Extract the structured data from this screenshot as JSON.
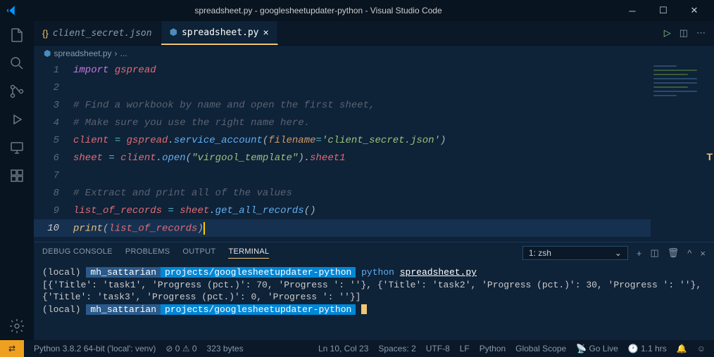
{
  "window": {
    "title": "spreadsheet.py - googlesheetupdater-python - Visual Studio Code"
  },
  "tabs": [
    {
      "icon": "{}",
      "label": "client_secret.json",
      "active": false
    },
    {
      "icon": "🐍",
      "label": "spreadsheet.py",
      "active": true
    }
  ],
  "breadcrumb": {
    "icon": "🐍",
    "file": "spreadsheet.py",
    "more": "..."
  },
  "editor": {
    "lines": [
      {
        "num": 1,
        "tokens": [
          [
            "kw",
            "import"
          ],
          [
            "",
            " "
          ],
          [
            "mod",
            "gspread"
          ]
        ]
      },
      {
        "num": 2,
        "tokens": []
      },
      {
        "num": 3,
        "tokens": [
          [
            "comment",
            "# Find a workbook by name and open the first sheet,"
          ]
        ]
      },
      {
        "num": 4,
        "tokens": [
          [
            "comment",
            "# Make sure you use the right name here."
          ]
        ]
      },
      {
        "num": 5,
        "tokens": [
          [
            "ident",
            "client"
          ],
          [
            "",
            " "
          ],
          [
            "op",
            "="
          ],
          [
            "",
            " "
          ],
          [
            "ident",
            "gspread"
          ],
          [
            "punct",
            "."
          ],
          [
            "func",
            "service_account"
          ],
          [
            "punct",
            "("
          ],
          [
            "param",
            "filename"
          ],
          [
            "op",
            "="
          ],
          [
            "string",
            "'client_secret.json'"
          ],
          [
            "punct",
            ")"
          ]
        ]
      },
      {
        "num": 6,
        "tokens": [
          [
            "ident",
            "sheet"
          ],
          [
            "",
            " "
          ],
          [
            "op",
            "="
          ],
          [
            "",
            " "
          ],
          [
            "ident",
            "client"
          ],
          [
            "punct",
            "."
          ],
          [
            "func",
            "open"
          ],
          [
            "punct",
            "("
          ],
          [
            "string",
            "\"virgool_template\""
          ],
          [
            "punct",
            ")"
          ],
          [
            "punct",
            "."
          ],
          [
            "ident",
            "sheet1"
          ]
        ]
      },
      {
        "num": 7,
        "tokens": []
      },
      {
        "num": 8,
        "tokens": [
          [
            "comment",
            "# Extract and print all of the values"
          ]
        ]
      },
      {
        "num": 9,
        "tokens": [
          [
            "ident",
            "list_of_records"
          ],
          [
            "",
            " "
          ],
          [
            "op",
            "="
          ],
          [
            "",
            " "
          ],
          [
            "ident",
            "sheet"
          ],
          [
            "punct",
            "."
          ],
          [
            "func",
            "get_all_records"
          ],
          [
            "punct",
            "()"
          ]
        ]
      },
      {
        "num": 10,
        "highlighted": true,
        "tokens": [
          [
            "builtin",
            "print"
          ],
          [
            "punct",
            "("
          ],
          [
            "ident",
            "list_of_records"
          ],
          [
            "punct",
            ")"
          ]
        ],
        "cursor": true
      }
    ]
  },
  "panel": {
    "tabs": [
      "DEBUG CONSOLE",
      "PROBLEMS",
      "OUTPUT",
      "TERMINAL"
    ],
    "active": "TERMINAL",
    "term_select": "1: zsh"
  },
  "terminal": {
    "local": "(local)",
    "user": "mh_sattarian",
    "path": "projects/googlesheetupdater-python",
    "cmd": "python",
    "file": "spreadsheet.py",
    "output": "[{'Title': 'task1', 'Progress (pct.)': 70, 'Progress ': ''}, {'Title': 'task2', 'Progress (pct.)': 30, 'Progress ': ''}, {'Title': 'task3', 'Progress (pct.)': 0, 'Progress ': ''}]"
  },
  "status": {
    "python": "Python 3.8.2 64-bit ('local': venv)",
    "errors": "0",
    "warnings": "0",
    "size": "323 bytes",
    "pos": "Ln 10, Col 23",
    "spaces": "Spaces: 2",
    "encoding": "UTF-8",
    "eol": "LF",
    "lang": "Python",
    "scope": "Global Scope",
    "golive": "Go Live",
    "time": "1.1 hrs"
  }
}
